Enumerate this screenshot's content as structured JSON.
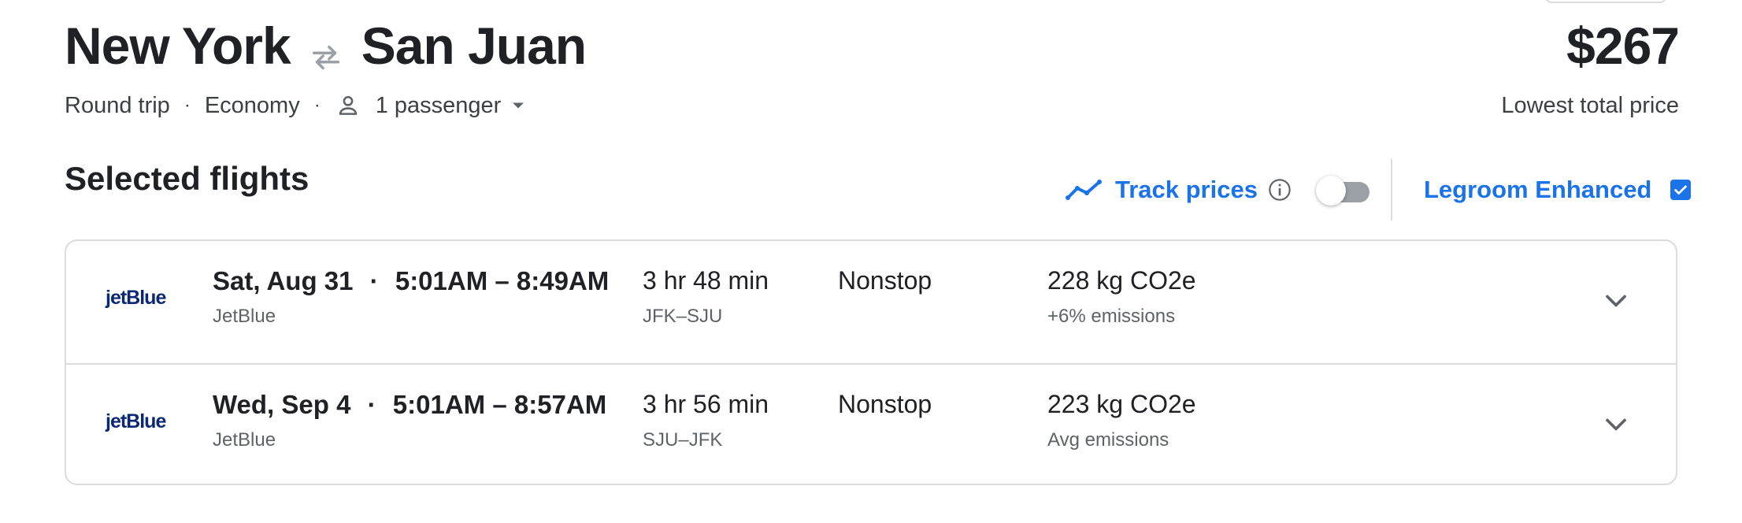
{
  "route": {
    "origin": "New York",
    "destination": "San Juan",
    "swap_icon": "swap-arrows-icon"
  },
  "trip": {
    "type": "Round trip",
    "separator": "·",
    "cabin": "Economy",
    "passengers": "1 passenger",
    "passenger_icon": "person-icon",
    "dropdown_icon": "caret-down-icon"
  },
  "price": {
    "amount": "$267",
    "label": "Lowest total price"
  },
  "section": {
    "title": "Selected flights"
  },
  "track_prices": {
    "label": "Track prices",
    "enabled": false,
    "icon": "trend-line-icon"
  },
  "legroom": {
    "label": "Legroom Enhanced",
    "checked": true
  },
  "flights": [
    {
      "logo": "jetBlue",
      "date": "Sat, Aug 31",
      "separator": "·",
      "times": "5:01AM – 8:49AM",
      "airline": "JetBlue",
      "duration": "3 hr 48 min",
      "airports": "JFK–SJU",
      "stops": "Nonstop",
      "co2": "228 kg CO2e",
      "emissions": "+6% emissions"
    },
    {
      "logo": "jetBlue",
      "date": "Wed, Sep 4",
      "separator": "·",
      "times": "5:01AM – 8:57AM",
      "airline": "JetBlue",
      "duration": "3 hr 56 min",
      "airports": "SJU–JFK",
      "stops": "Nonstop",
      "co2": "223 kg CO2e",
      "emissions": "Avg emissions"
    }
  ],
  "colors": {
    "accent": "#1a73e8",
    "text": "#202124",
    "muted": "#5f6368",
    "border": "#dadce0",
    "jetblue": "#0c2773"
  }
}
